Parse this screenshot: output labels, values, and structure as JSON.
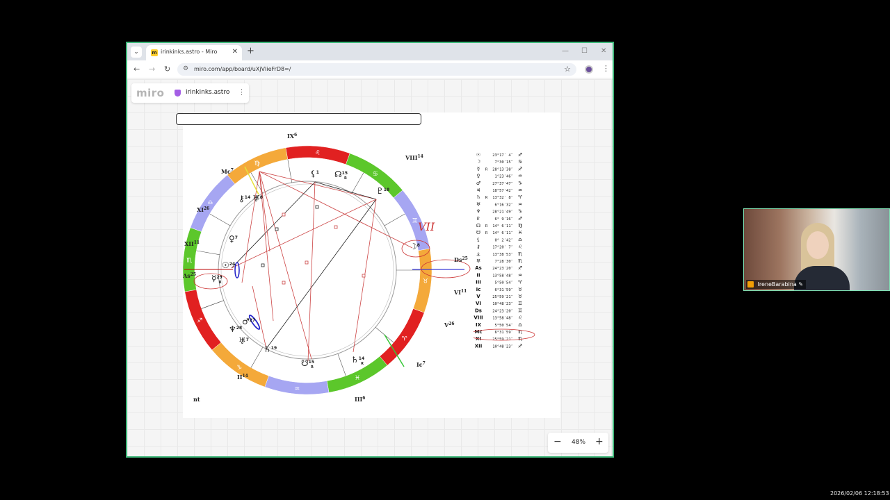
{
  "browser": {
    "tab_title": "irinkinks.astro - Miro",
    "tab_close": "✕",
    "new_tab": "+",
    "url": "miro.com/app/board/uXjVIieFrD8=/",
    "controls": {
      "minimize": "—",
      "maximize": "☐",
      "close": "✕"
    },
    "nav": {
      "back": "←",
      "forward": "→",
      "reload": "↻"
    },
    "favicon_letter": "m"
  },
  "miro": {
    "logo": "miro",
    "board_name": "irinkinks.astro",
    "menu": "⋮",
    "zoom_level": "48%",
    "zoom_minus": "−",
    "zoom_plus": "+"
  },
  "chart": {
    "footer_mark": "nt",
    "houses": [
      {
        "label": "IX",
        "num": "6"
      },
      {
        "label": "VIII",
        "num": "14"
      },
      {
        "label": "Mc",
        "num": "7"
      },
      {
        "label": "XI",
        "num": "26"
      },
      {
        "label": "XII",
        "num": "11"
      },
      {
        "label": "As",
        "num": "25"
      },
      {
        "label": "Ds",
        "num": "25"
      },
      {
        "label": "VI",
        "num": "11"
      },
      {
        "label": "V",
        "num": "26"
      },
      {
        "label": "Ic",
        "num": "7"
      },
      {
        "label": "III",
        "num": "6"
      },
      {
        "label": "II",
        "num": "14"
      }
    ],
    "sign_glyphs": [
      "♎",
      "♍",
      "♌",
      "♋",
      "♊",
      "♉",
      "♈",
      "♓",
      "♒",
      "♑",
      "♐",
      "♏"
    ],
    "planet_marks": [
      {
        "glyph": "⚸",
        "num": "1"
      },
      {
        "glyph": "☊",
        "num": "15",
        "r": "R"
      },
      {
        "glyph": "♇",
        "num": "18"
      },
      {
        "glyph": "♅",
        "num": "8"
      },
      {
        "glyph": "⚷",
        "num": "14"
      },
      {
        "glyph": "♀",
        "num": "7"
      },
      {
        "glyph": "☉",
        "num": "24"
      },
      {
        "glyph": "☿",
        "num": "29",
        "r": "R"
      },
      {
        "glyph": "☽",
        "num": "8"
      },
      {
        "glyph": "♆",
        "num": "28"
      },
      {
        "glyph": "♂",
        "num": "27"
      },
      {
        "glyph": "♄",
        "num": "19"
      },
      {
        "glyph": "☋",
        "num": "15",
        "r": "R"
      },
      {
        "glyph": "♄",
        "num": "14",
        "r": "R"
      },
      {
        "glyph": "♅",
        "num": "7"
      }
    ],
    "handwritten_note": "VII",
    "table": [
      {
        "glyph": "☉",
        "r": "",
        "pos": "23°17′ 4″",
        "sign": "♐"
      },
      {
        "glyph": "☽",
        "r": "",
        "pos": "7°30′15″",
        "sign": "♋"
      },
      {
        "glyph": "☿",
        "r": "R",
        "pos": "28°13′38″",
        "sign": "♐"
      },
      {
        "glyph": "♀",
        "r": "",
        "pos": "1°23′46″",
        "sign": "♒"
      },
      {
        "glyph": "♂",
        "r": "",
        "pos": "27°37′47″",
        "sign": "♑"
      },
      {
        "glyph": "♃",
        "r": "",
        "pos": "18°57′42″",
        "sign": "♒"
      },
      {
        "glyph": "♄",
        "r": "R",
        "pos": "13°32′ 8″",
        "sign": "♈"
      },
      {
        "glyph": "♅",
        "r": "",
        "pos": "6°16′32″",
        "sign": "♒"
      },
      {
        "glyph": "♆",
        "r": "",
        "pos": "28°21′49″",
        "sign": "♑"
      },
      {
        "glyph": "♇",
        "r": "",
        "pos": "6° 9′16″",
        "sign": "♐"
      },
      {
        "glyph": "☊",
        "r": "R",
        "pos": "14° 6′11″",
        "sign": "♍"
      },
      {
        "glyph": "☋",
        "r": "R",
        "pos": "14° 6′11″",
        "sign": "♓"
      },
      {
        "glyph": "⚸",
        "r": "",
        "pos": "0° 2′42″",
        "sign": "♎"
      },
      {
        "glyph": "⚷",
        "r": "",
        "pos": "17°20′ 7″",
        "sign": "♌"
      },
      {
        "glyph": "⚶",
        "r": "",
        "pos": "13°38′53″",
        "sign": "♏"
      },
      {
        "glyph": "♅",
        "r": "",
        "pos": "7°28′30″",
        "sign": "♏"
      },
      {
        "glyph": "As",
        "r": "",
        "pos": "24°23′20″",
        "sign": "♐"
      },
      {
        "glyph": "II",
        "r": "",
        "pos": "13°58′48″",
        "sign": "♒"
      },
      {
        "glyph": "III",
        "r": "",
        "pos": "5°50′54″",
        "sign": "♈"
      },
      {
        "glyph": "Ic",
        "r": "",
        "pos": "6°31′59″",
        "sign": "♉"
      },
      {
        "glyph": "V",
        "r": "",
        "pos": "25°59′21″",
        "sign": "♉"
      },
      {
        "glyph": "VI",
        "r": "",
        "pos": "10°48′23″",
        "sign": "♊"
      },
      {
        "glyph": "Ds",
        "r": "",
        "pos": "24°23′20″",
        "sign": "♊"
      },
      {
        "glyph": "VIII",
        "r": "",
        "pos": "13°58′48″",
        "sign": "♌"
      },
      {
        "glyph": "IX",
        "r": "",
        "pos": "5°50′54″",
        "sign": "♎"
      },
      {
        "glyph": "Mc",
        "r": "",
        "pos": "6°31′59″",
        "sign": "♏"
      },
      {
        "glyph": "XI",
        "r": "",
        "pos": "25°59′21″",
        "sign": "♏"
      },
      {
        "glyph": "XII",
        "r": "",
        "pos": "10°48′23″",
        "sign": "♐"
      }
    ]
  },
  "video": {
    "participant_name": "IreneBarabina"
  },
  "timestamp": "2026/02/06 12:18:53"
}
